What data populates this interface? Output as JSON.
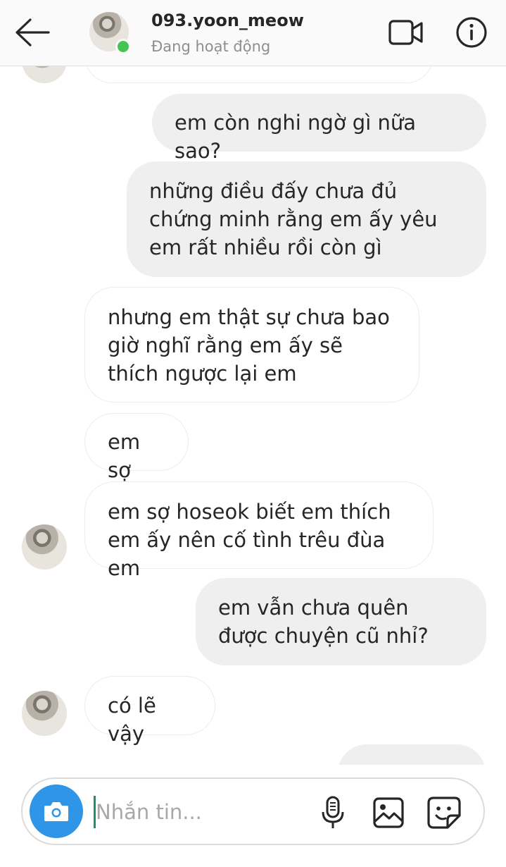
{
  "header": {
    "username": "093.yoon_meow",
    "status": "Đang hoạt động"
  },
  "messages": [
    {
      "side": "in",
      "text": ""
    },
    {
      "side": "out",
      "text": "em còn nghi ngờ gì nữa sao?"
    },
    {
      "side": "out",
      "text": "những điều đấy chưa đủ chứng minh rằng em ấy yêu em rất nhiều rồi còn gì"
    },
    {
      "side": "in",
      "text": "nhưng em thật sự chưa bao giờ nghĩ rằng em ấy sẽ thích ngược lại em"
    },
    {
      "side": "in",
      "text": "em sợ"
    },
    {
      "side": "in",
      "text": "em sợ hoseok biết em thích em ấy nên cố tình trêu đùa em"
    },
    {
      "side": "out",
      "text": "em vẫn chưa quên được chuyện cũ nhỉ?"
    },
    {
      "side": "in",
      "text": "có lẽ vậy"
    },
    {
      "side": "out",
      "text": ""
    }
  ],
  "composer": {
    "placeholder": "Nhắn tin..."
  },
  "icons": {
    "back": "arrow-left-icon",
    "video": "video-camera-icon",
    "info": "info-icon",
    "camera": "camera-icon",
    "mic": "microphone-icon",
    "gallery": "image-icon",
    "sticker": "sticker-icon"
  },
  "colors": {
    "online": "#44c553",
    "camera_button": "#2f95e6",
    "outgoing_bubble": "#efefef",
    "incoming_border": "#ececec"
  }
}
